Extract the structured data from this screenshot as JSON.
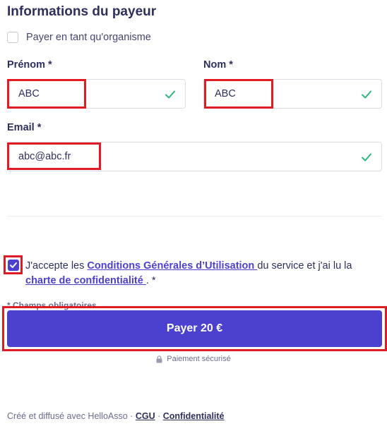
{
  "section_title": "Informations du payeur",
  "org_option": {
    "label": "Payer en tant qu'organisme",
    "checked": false
  },
  "fields": {
    "first_name": {
      "label": "Prénom *",
      "value": "ABC"
    },
    "last_name": {
      "label": "Nom *",
      "value": "ABC"
    },
    "email": {
      "label": "Email *",
      "value": "abc@abc.fr"
    }
  },
  "terms": {
    "checked": true,
    "prefix": "J'accepte les ",
    "cgu_link": "Conditions Générales d’Utilisation ",
    "middle": " du service et j'ai lu la ",
    "charter_link": "charte de confidentialité ",
    "suffix": " . *"
  },
  "required_note": "* Champs obligatoires",
  "pay_button": "Payer 20 €",
  "secure_label": "Paiement sécurisé",
  "footer": {
    "text": "Créé et diffusé avec HelloAsso · ",
    "cgu": "CGU",
    "separator": " · ",
    "privacy": "Confidentialité"
  },
  "colors": {
    "accent": "#4c40cf",
    "valid": "#2eb67d",
    "highlight": "#e01b24"
  },
  "icons": [
    "checkmark-icon",
    "lock-icon"
  ]
}
